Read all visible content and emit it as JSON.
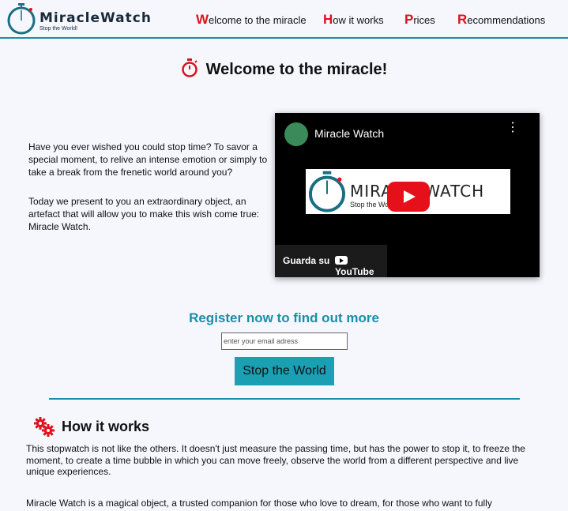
{
  "brand": {
    "name": "MiracleWatch",
    "tagline": "Stop the World!"
  },
  "nav": [
    {
      "cap": "W",
      "rest": "elcome to the miracle"
    },
    {
      "cap": "H",
      "rest": "ow it works"
    },
    {
      "cap": "P",
      "rest": "rices"
    },
    {
      "cap": "R",
      "rest": "ecommendations"
    }
  ],
  "hero": {
    "title": "Welcome to the miracle!",
    "paragraphs": [
      "Have you ever wished you could stop time? To savor a special moment, to relive an intense emotion or simply to take a break from the frenetic world around you?",
      "Today we present to you an extraordinary object, an artefact that will allow you to make this wish come true: Miracle Watch."
    ]
  },
  "video": {
    "title": "Miracle Watch",
    "thumb_logo": "MIRACLEWATCH",
    "thumb_tag": "Stop the World!",
    "watch_on": "Guarda su",
    "platform": "YouTube"
  },
  "register": {
    "title": "Register now to find out more",
    "email_placeholder": "enter your email adress",
    "button": "Stop the World"
  },
  "how": {
    "title": "How it works",
    "paragraphs": [
      "This stopwatch is not like the others. It doesn't just measure the passing time, but has the power to stop it, to freeze the moment, to create a time bubble in which you can move freely, observe the world from a different perspective and live unique experiences.",
      "Miracle Watch is a magical object, a trusted companion for those who love to dream, for those who want to fully"
    ]
  },
  "colors": {
    "accent": "#1a8ea8",
    "nav_cap": "#e0101c",
    "button": "#1a9fb3",
    "background": "#f5f7fd"
  },
  "icons": [
    "stopwatch-logo-icon",
    "stopwatch-icon",
    "gears-icon",
    "youtube-play-icon",
    "more-vert-icon"
  ]
}
